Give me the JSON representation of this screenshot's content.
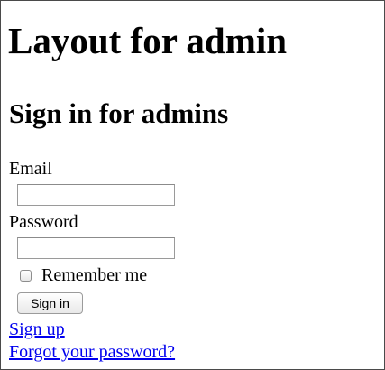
{
  "page": {
    "title": "Layout for admin"
  },
  "form": {
    "title": "Sign in for admins",
    "email_label": "Email",
    "email_value": "",
    "password_label": "Password",
    "password_value": "",
    "remember_label": "Remember me",
    "remember_checked": false,
    "submit_label": "Sign in"
  },
  "links": {
    "signup": "Sign up",
    "forgot_password": "Forgot your password?"
  },
  "colors": {
    "link": "#0000ee",
    "frame_border": "#4a4a4a"
  }
}
